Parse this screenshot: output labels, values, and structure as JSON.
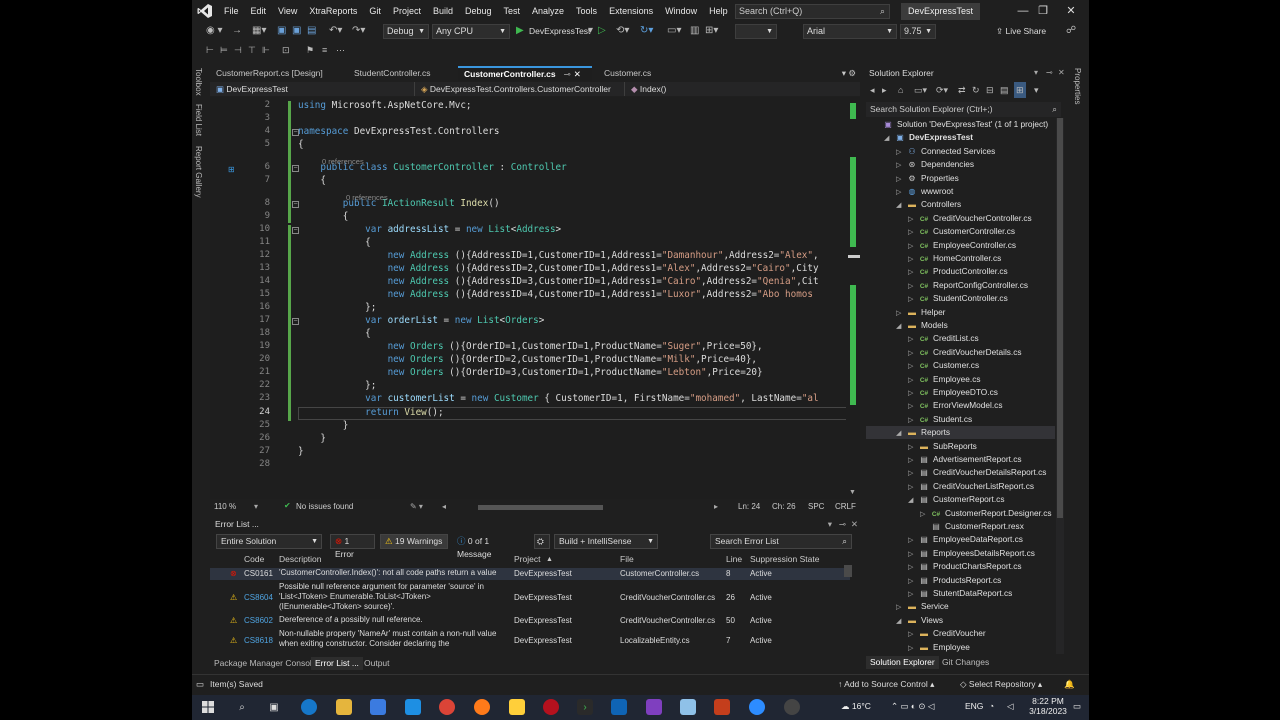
{
  "menubar": {
    "items": [
      "File",
      "Edit",
      "View",
      "XtraReports",
      "Git",
      "Project",
      "Build",
      "Debug",
      "Test",
      "Analyze",
      "Tools",
      "Extensions",
      "Window",
      "Help"
    ],
    "search_placeholder": "Search (Ctrl+Q)",
    "solution_name": "DevExpressTest"
  },
  "toolbar": {
    "config": "Debug",
    "platform": "Any CPU",
    "run_target": "DevExpressTest",
    "font_name": "Arial",
    "font_size": "9.75",
    "live_share": "Live Share"
  },
  "left_strip": [
    "Toolbox",
    "Field List",
    "Report Gallery"
  ],
  "right_strip": [
    "Properties"
  ],
  "tabs": [
    {
      "label": "CustomerReport.cs [Design]",
      "active": false
    },
    {
      "label": "StudentController.cs",
      "active": false
    },
    {
      "label": "CustomerController.cs",
      "active": true
    },
    {
      "label": "Customer.cs",
      "active": false
    }
  ],
  "navbar": {
    "project": "DevExpressTest",
    "type": "DevExpressTest.Controllers.CustomerController",
    "member": "Index()"
  },
  "code": {
    "line_numbers": [
      "2",
      "3",
      "4",
      "5",
      "6",
      "7",
      "8",
      "9",
      "10",
      "11",
      "12",
      "13",
      "14",
      "15",
      "16",
      "17",
      "18",
      "19",
      "20",
      "21",
      "22",
      "23",
      "24",
      "25",
      "26",
      "27",
      "28"
    ],
    "current_line": "24",
    "ref_label": "0 references"
  },
  "editor_status": {
    "zoom": "110 %",
    "issues": "No issues found",
    "position": "Ln: 24",
    "char": "Ch: 26",
    "spc": "SPC",
    "eol": "CRLF"
  },
  "error_list": {
    "title": "Error List ...",
    "scope": "Entire Solution",
    "errors": "1 Error",
    "warnings": "19 Warnings",
    "messages": "0 of 1 Message",
    "build_filter": "Build + IntelliSense",
    "search_placeholder": "Search Error List",
    "columns": [
      "Code",
      "Description",
      "Project",
      "File",
      "Line",
      "Suppression State"
    ],
    "rows": [
      {
        "kind": "error",
        "code": "CS0161",
        "desc": "'CustomerController.Index()': not all code paths return a value",
        "project": "DevExpressTest",
        "file": "CustomerController.cs",
        "line": "8",
        "state": "Active"
      },
      {
        "kind": "warning",
        "code": "CS8604",
        "desc": "Possible null reference argument for parameter 'source' in 'List<JToken> Enumerable.ToList<JToken>(IEnumerable<JToken> source)'.",
        "project": "DevExpressTest",
        "file": "CreditVoucherController.cs",
        "line": "26",
        "state": "Active"
      },
      {
        "kind": "warning",
        "code": "CS8602",
        "desc": "Dereference of a possibly null reference.",
        "project": "DevExpressTest",
        "file": "CreditVoucherController.cs",
        "line": "50",
        "state": "Active"
      },
      {
        "kind": "warning",
        "code": "CS8618",
        "desc": "Non-nullable property 'NameAr' must contain a non-null value when exiting constructor. Consider declaring the",
        "project": "DevExpressTest",
        "file": "LocalizableEntity.cs",
        "line": "7",
        "state": "Active"
      }
    ]
  },
  "bottom_tabs": [
    {
      "label": "Package Manager Console",
      "active": false
    },
    {
      "label": "Error List ...",
      "active": true
    },
    {
      "label": "Output",
      "active": false
    }
  ],
  "solution_explorer": {
    "title": "Solution Explorer",
    "search_placeholder": "Search Solution Explorer (Ctrl+;)",
    "tabs": [
      "Solution Explorer",
      "Git Changes"
    ],
    "nodes": [
      {
        "label": "Solution 'DevExpressTest' (1 of 1 project)",
        "indent": 0,
        "arrow": "",
        "icon": "sln"
      },
      {
        "label": "DevExpressTest",
        "indent": 1,
        "arrow": "down",
        "icon": "proj"
      },
      {
        "label": "Connected Services",
        "indent": 2,
        "arrow": "right",
        "icon": "svc"
      },
      {
        "label": "Dependencies",
        "indent": 2,
        "arrow": "right",
        "icon": "dep"
      },
      {
        "label": "Properties",
        "indent": 2,
        "arrow": "right",
        "icon": "prop"
      },
      {
        "label": "wwwroot",
        "indent": 2,
        "arrow": "right",
        "icon": "web"
      },
      {
        "label": "Controllers",
        "indent": 2,
        "arrow": "down",
        "icon": "folder"
      },
      {
        "label": "CreditVoucherController.cs",
        "indent": 3,
        "arrow": "right",
        "icon": "cs"
      },
      {
        "label": "CustomerController.cs",
        "indent": 3,
        "arrow": "right",
        "icon": "cs"
      },
      {
        "label": "EmployeeController.cs",
        "indent": 3,
        "arrow": "right",
        "icon": "cs"
      },
      {
        "label": "HomeController.cs",
        "indent": 3,
        "arrow": "right",
        "icon": "cs"
      },
      {
        "label": "ProductController.cs",
        "indent": 3,
        "arrow": "right",
        "icon": "cs"
      },
      {
        "label": "ReportConfigController.cs",
        "indent": 3,
        "arrow": "right",
        "icon": "cs"
      },
      {
        "label": "StudentController.cs",
        "indent": 3,
        "arrow": "right",
        "icon": "cs"
      },
      {
        "label": "Helper",
        "indent": 2,
        "arrow": "right",
        "icon": "folder"
      },
      {
        "label": "Models",
        "indent": 2,
        "arrow": "down",
        "icon": "folder"
      },
      {
        "label": "CreditList.cs",
        "indent": 3,
        "arrow": "right",
        "icon": "cs"
      },
      {
        "label": "CreditVoucherDetails.cs",
        "indent": 3,
        "arrow": "right",
        "icon": "cs"
      },
      {
        "label": "Customer.cs",
        "indent": 3,
        "arrow": "right",
        "icon": "cs"
      },
      {
        "label": "Employee.cs",
        "indent": 3,
        "arrow": "right",
        "icon": "cs"
      },
      {
        "label": "EmployeeDTO.cs",
        "indent": 3,
        "arrow": "right",
        "icon": "cs"
      },
      {
        "label": "ErrorViewModel.cs",
        "indent": 3,
        "arrow": "right",
        "icon": "cs"
      },
      {
        "label": "Student.cs",
        "indent": 3,
        "arrow": "right",
        "icon": "cs"
      },
      {
        "label": "Reports",
        "indent": 2,
        "arrow": "down",
        "icon": "folder",
        "selected": true
      },
      {
        "label": "SubReports",
        "indent": 3,
        "arrow": "right",
        "icon": "folder"
      },
      {
        "label": "AdvertisementReport.cs",
        "indent": 3,
        "arrow": "right",
        "icon": "rpt"
      },
      {
        "label": "CreditVoucherDetailsReport.cs",
        "indent": 3,
        "arrow": "right",
        "icon": "rpt"
      },
      {
        "label": "CreditVoucherListReport.cs",
        "indent": 3,
        "arrow": "right",
        "icon": "rpt"
      },
      {
        "label": "CustomerReport.cs",
        "indent": 3,
        "arrow": "down",
        "icon": "rpt"
      },
      {
        "label": "CustomerReport.Designer.cs",
        "indent": 4,
        "arrow": "right",
        "icon": "cs"
      },
      {
        "label": "CustomerReport.resx",
        "indent": 4,
        "arrow": "",
        "icon": "resx"
      },
      {
        "label": "EmployeeDataReport.cs",
        "indent": 3,
        "arrow": "right",
        "icon": "rpt"
      },
      {
        "label": "EmployeesDetailsReport.cs",
        "indent": 3,
        "arrow": "right",
        "icon": "rpt"
      },
      {
        "label": "ProductChartsReport.cs",
        "indent": 3,
        "arrow": "right",
        "icon": "rpt"
      },
      {
        "label": "ProductsReport.cs",
        "indent": 3,
        "arrow": "right",
        "icon": "rpt"
      },
      {
        "label": "StutentDataReport.cs",
        "indent": 3,
        "arrow": "right",
        "icon": "rpt"
      },
      {
        "label": "Service",
        "indent": 2,
        "arrow": "right",
        "icon": "folder"
      },
      {
        "label": "Views",
        "indent": 2,
        "arrow": "down",
        "icon": "folder"
      },
      {
        "label": "CreditVoucher",
        "indent": 3,
        "arrow": "right",
        "icon": "folder"
      },
      {
        "label": "Employee",
        "indent": 3,
        "arrow": "right",
        "icon": "folder"
      }
    ]
  },
  "statusbar": {
    "message": "Item(s) Saved",
    "source_control": "Add to Source Control",
    "repository": "Select Repository"
  },
  "taskbar": {
    "weather": "16°C",
    "lang": "ENG",
    "time": "8:22 PM",
    "date": "3/18/2023"
  },
  "colors": {
    "editor_bg": "#1e1e1e",
    "keyword": "#569cd6",
    "type": "#4ec9b0",
    "string": "#d69d85",
    "accent": "#3a96dd",
    "error": "#e51400",
    "warning": "#f5c518"
  }
}
